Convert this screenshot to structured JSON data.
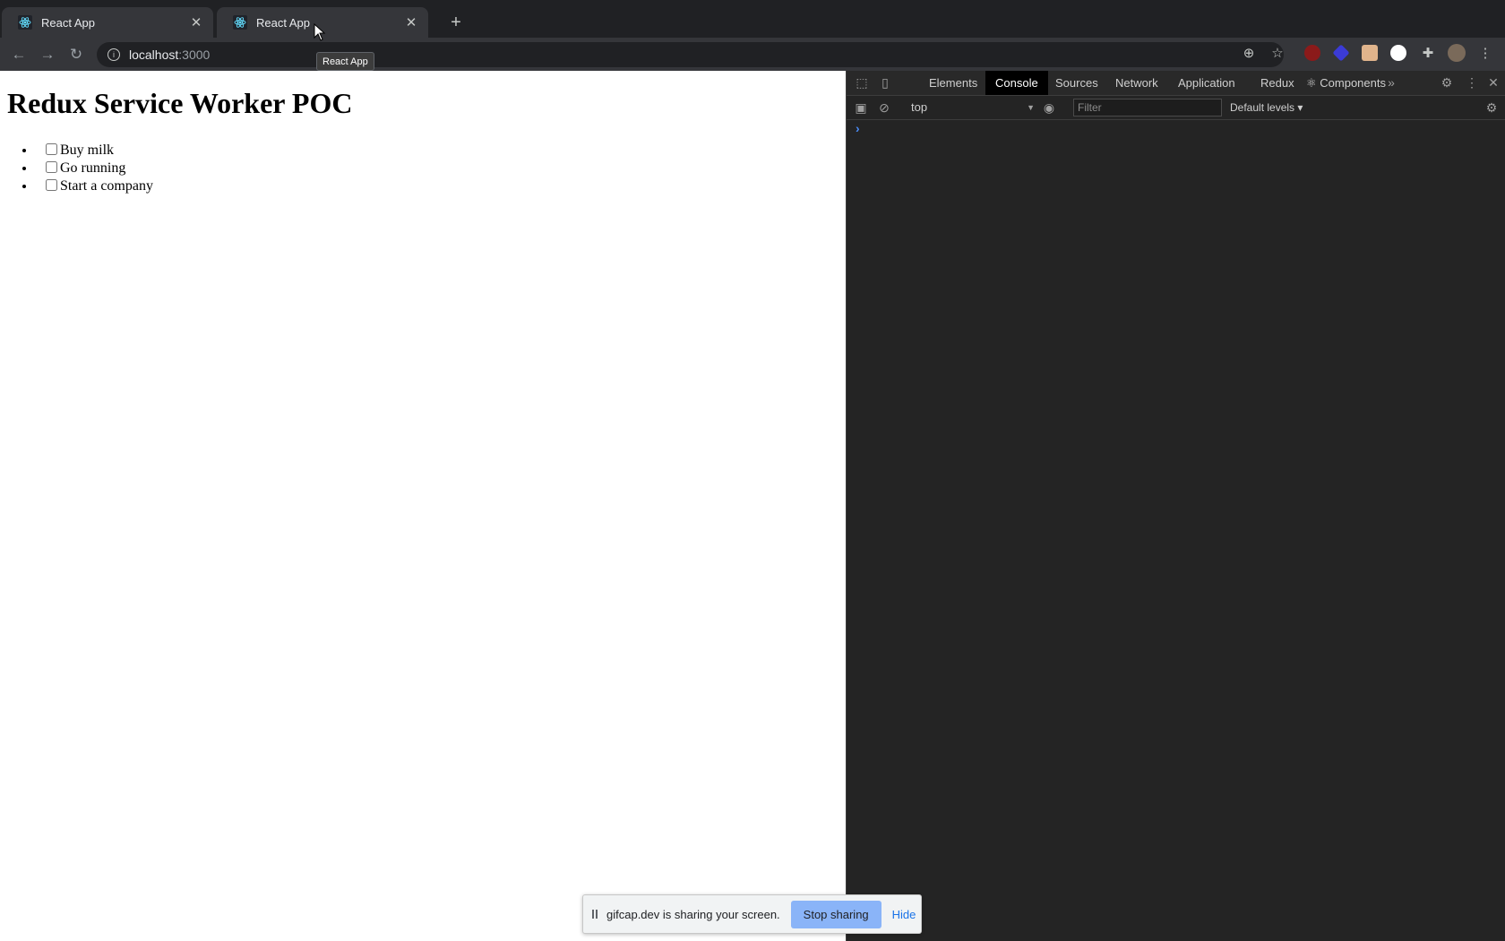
{
  "browser": {
    "tabs": [
      {
        "title": "React App",
        "close": "✕"
      },
      {
        "title": "React App",
        "close": "✕"
      }
    ],
    "new_tab": "+",
    "address": {
      "host": "localhost",
      "port": ":3000"
    },
    "tooltip": "React App",
    "icons": [
      "back-icon",
      "forward-icon",
      "reload-icon",
      "info-icon",
      "install-icon",
      "star-icon",
      "extension-ublock-icon",
      "extension-blue-icon",
      "extension-face-icon",
      "extension-search-icon",
      "extensions-puzzle-icon",
      "profile-avatar",
      "menu-icon"
    ]
  },
  "page": {
    "heading": "Redux Service Worker POC",
    "todos": [
      {
        "label": "Buy milk",
        "checked": false
      },
      {
        "label": "Go running",
        "checked": false
      },
      {
        "label": "Start a company",
        "checked": false
      }
    ]
  },
  "devtools": {
    "tabs": [
      "Elements",
      "Console",
      "Sources",
      "Network",
      "Application",
      "Redux",
      "⚛ Components"
    ],
    "active_tab": "Console",
    "more_tabs": "»",
    "context": "top",
    "filter_placeholder": "Filter",
    "levels": "Default levels ▾",
    "prompt": "›"
  },
  "share_bar": {
    "message": "gifcap.dev is sharing your screen.",
    "stop_label": "Stop sharing",
    "hide_label": "Hide"
  },
  "colors": {
    "tabstrip": "#202124",
    "toolbar": "#35363a",
    "devtools_bg": "#242424",
    "accent": "#8ab4f8"
  }
}
